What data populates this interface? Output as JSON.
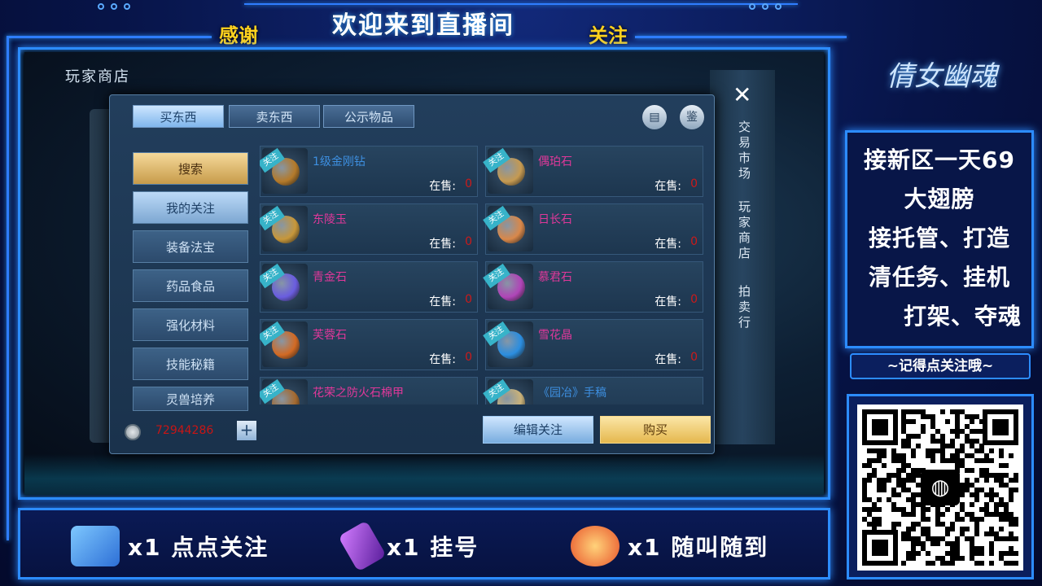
{
  "overlay": {
    "banner_title": "欢迎来到直播间",
    "banner_left": "感谢",
    "banner_right": "关注",
    "logo": "倩女幽魂",
    "promo_lines": [
      "接新区一天69",
      "大翅膀",
      "接托管、打造",
      "清任务、挂机",
      "打架、夺魂"
    ],
    "remind": "~记得点关注哦~",
    "bottom_gifts": [
      {
        "icon": "fan-badge-icon",
        "text": "x1  点点关注"
      },
      {
        "icon": "purple-rocket-icon",
        "text": "x1  挂号"
      },
      {
        "icon": "fire-rocket-icon",
        "text": "x1  随叫随到"
      }
    ]
  },
  "game": {
    "shop_title": "玩家商店",
    "tabs": [
      "买东西",
      "卖东西",
      "公示物品"
    ],
    "right_buttons": [
      "鉴"
    ],
    "categories": [
      "搜索",
      "我的关注",
      "装备法宝",
      "药品食品",
      "强化材料",
      "技能秘籍",
      "灵兽培养"
    ],
    "tag_label": "关注",
    "sale_label": "在售:",
    "items": [
      {
        "name": "1级金刚钻",
        "count": "0",
        "name_color": "#3d8fe0",
        "gem": "#b47a2a"
      },
      {
        "name": "偶珀石",
        "count": "0",
        "name_color": "#e0389a",
        "gem": "#c59a52"
      },
      {
        "name": "东陵玉",
        "count": "0",
        "name_color": "#e0389a",
        "gem": "#c7973a"
      },
      {
        "name": "日长石",
        "count": "0",
        "name_color": "#e0389a",
        "gem": "#d9884a"
      },
      {
        "name": "青金石",
        "count": "0",
        "name_color": "#e0389a",
        "gem": "#6a5de0"
      },
      {
        "name": "慕君石",
        "count": "0",
        "name_color": "#e0389a",
        "gem": "#b045b8"
      },
      {
        "name": "芙蓉石",
        "count": "0",
        "name_color": "#e0389a",
        "gem": "#d26a24"
      },
      {
        "name": "雪花晶",
        "count": "0",
        "name_color": "#e0389a",
        "gem": "#2b8ee0"
      },
      {
        "name": "花荣之防火石棉甲",
        "count": "",
        "name_color": "#e0389a",
        "gem": "#a46a30"
      },
      {
        "name": "《园冶》手稿",
        "count": "",
        "name_color": "#3d8fe0",
        "gem": "#c9b27a"
      }
    ],
    "money": "72944286",
    "edit_button": "编辑关注",
    "buy_button": "购买",
    "close": "✕",
    "side_tabs": [
      "交易市场",
      "玩家商店",
      "拍卖行"
    ]
  }
}
